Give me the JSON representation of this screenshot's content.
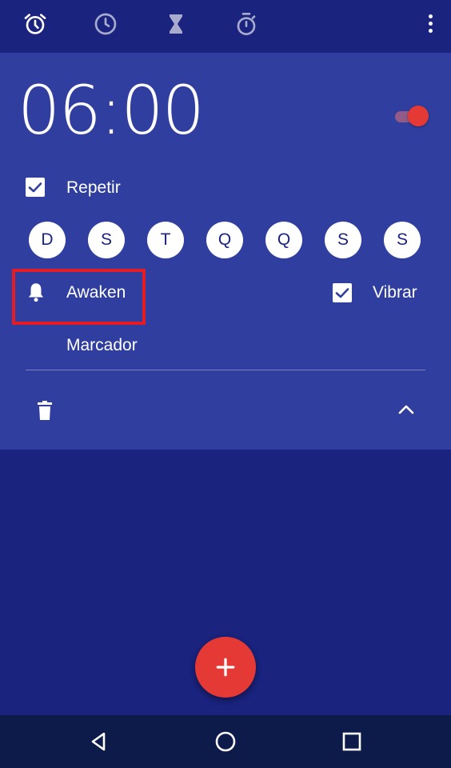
{
  "top_tabs": [
    {
      "icon": "alarm-icon",
      "name": "alarm"
    },
    {
      "icon": "clock-icon",
      "name": "clock"
    },
    {
      "icon": "hourglass-icon",
      "name": "timer"
    },
    {
      "icon": "stopwatch-icon",
      "name": "stopwatch"
    }
  ],
  "overflow_icon": "more-vert-icon",
  "alarm": {
    "time": "06:00",
    "enabled": true,
    "repeat_label": "Repetir",
    "repeat_checked": true,
    "days": [
      "D",
      "S",
      "T",
      "Q",
      "Q",
      "S",
      "S"
    ],
    "ringtone_label": "Awaken",
    "vibrate_label": "Vibrar",
    "vibrate_checked": true,
    "marker_label": "Marcador",
    "delete_icon": "trash-icon",
    "collapse_icon": "chevron-up-icon"
  },
  "fab_icon": "plus-icon",
  "nav": [
    "back-icon",
    "home-icon",
    "recents-icon"
  ],
  "colors": {
    "background": "#1a237e",
    "card": "#303f9f",
    "accent": "#e53935",
    "highlight": "#e51c23",
    "navbar": "#0d1b4b"
  }
}
